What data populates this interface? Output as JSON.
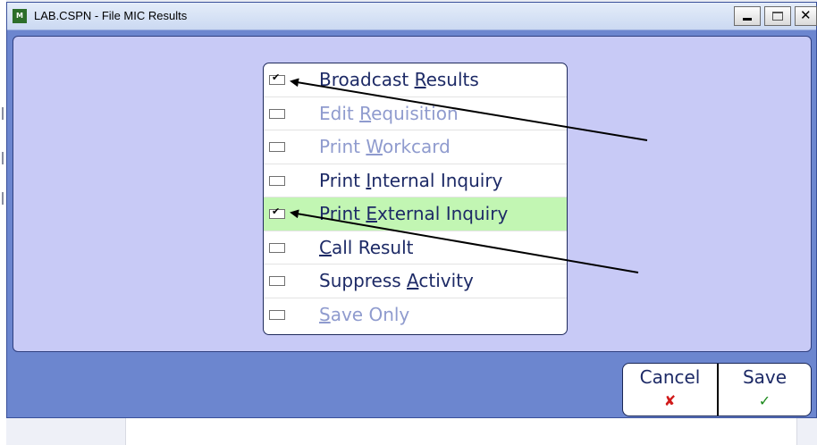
{
  "window": {
    "title": "LAB.CSPN - File MIC Results",
    "icon_name": "app-icon",
    "controls": [
      "minimize-icon",
      "maximize-icon",
      "close-icon"
    ]
  },
  "options": [
    {
      "label_pre": "Broadcast ",
      "label_key": "R",
      "label_post": "esults",
      "checked": true,
      "enabled": true
    },
    {
      "label_pre": "Edit ",
      "label_key": "R",
      "label_post": "equisition",
      "checked": false,
      "enabled": false
    },
    {
      "label_pre": "Print ",
      "label_key": "W",
      "label_post": "orkcard",
      "checked": false,
      "enabled": false
    },
    {
      "label_pre": "Print ",
      "label_key": "I",
      "label_post": "nternal Inquiry",
      "checked": false,
      "enabled": true
    },
    {
      "label_pre": "Print ",
      "label_key": "E",
      "label_post": "xternal Inquiry",
      "checked": true,
      "enabled": true
    },
    {
      "label_pre": "",
      "label_key": "C",
      "label_post": "all Result",
      "checked": false,
      "enabled": true
    },
    {
      "label_pre": "Suppress ",
      "label_key": "A",
      "label_post": "ctivity",
      "checked": false,
      "enabled": true
    },
    {
      "label_pre": "",
      "label_key": "S",
      "label_post": "ave Only",
      "checked": false,
      "enabled": false
    }
  ],
  "actions": {
    "cancel_label": "Cancel",
    "cancel_icon": "✘",
    "save_label": "Save",
    "save_icon": "✓"
  },
  "colors": {
    "window_bg": "#6c86cf",
    "panel_bg": "#c8caf6",
    "highlight_row": "#c2f6b3",
    "enabled_text": "#1d2a66",
    "disabled_text": "#8f9bce",
    "cancel_icon": "#d11a1a",
    "save_icon": "#1b8a1b"
  }
}
